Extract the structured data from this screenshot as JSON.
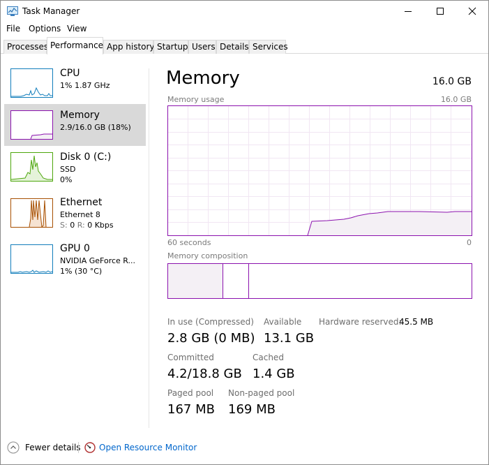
{
  "window": {
    "title": "Task Manager"
  },
  "menu": [
    "File",
    "Options",
    "View"
  ],
  "tabs": [
    "Processes",
    "Performance",
    "App history",
    "Startup",
    "Users",
    "Details",
    "Services"
  ],
  "resources": {
    "cpu": {
      "name": "CPU",
      "line1": "1%  1.87 GHz"
    },
    "memory": {
      "name": "Memory",
      "line1": "2.9/16.0 GB (18%)"
    },
    "disk": {
      "name": "Disk 0 (C:)",
      "line1": "SSD",
      "line2": "0%"
    },
    "ethernet": {
      "name": "Ethernet",
      "line1": "Ethernet 8",
      "s_label": "S:",
      "s_value": "0",
      "r_label": "R:",
      "r_value": "0 Kbps"
    },
    "gpu": {
      "name": "GPU 0",
      "line1": "NVIDIA GeForce R...",
      "line2": "1%  (30 °C)"
    }
  },
  "main": {
    "title": "Memory",
    "total": "16.0 GB",
    "usage_label": "Memory usage",
    "usage_max": "16.0 GB",
    "time_left": "60 seconds",
    "time_right": "0",
    "composition_label": "Memory composition"
  },
  "stats": {
    "in_use_label": "In use (Compressed)",
    "in_use_value": "2.8 GB (0 MB)",
    "available_label": "Available",
    "available_value": "13.1 GB",
    "hw_reserved_label": "Hardware reserved:",
    "hw_reserved_value": "45.5 MB",
    "committed_label": "Committed",
    "committed_value": "4.2/18.8 GB",
    "cached_label": "Cached",
    "cached_value": "1.4 GB",
    "paged_label": "Paged pool",
    "paged_value": "167 MB",
    "nonpaged_label": "Non-paged pool",
    "nonpaged_value": "169 MB"
  },
  "footer": {
    "fewer_details": "Fewer details",
    "resource_monitor": "Open Resource Monitor"
  },
  "colors": {
    "memory": "#8b12ae",
    "cpu": "#117dbb",
    "disk": "#4da60c",
    "ethernet": "#a74f01",
    "selected": "#d9d9d9"
  }
}
